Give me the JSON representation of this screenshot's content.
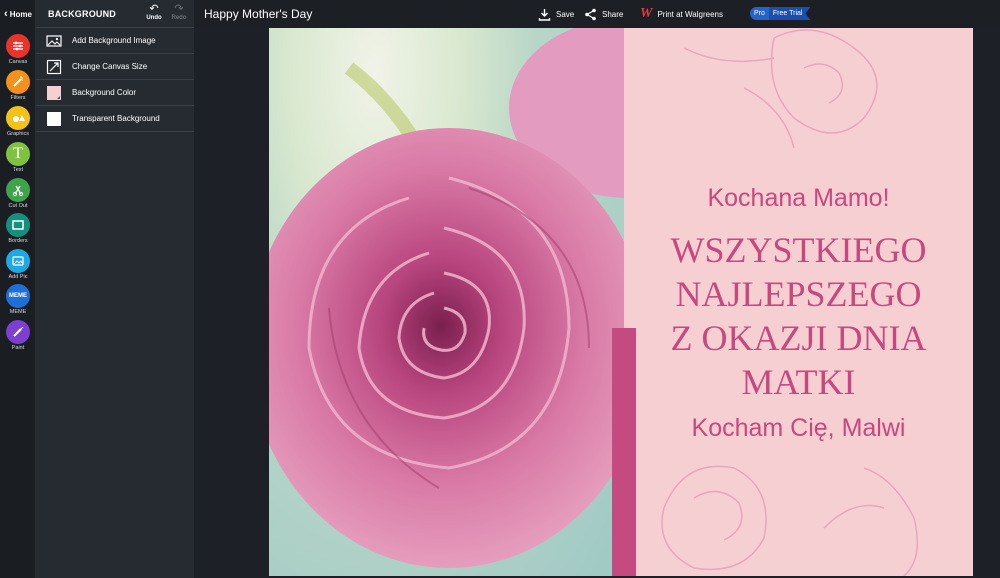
{
  "nav": {
    "home_label": "Home"
  },
  "tools": [
    {
      "label": "Canvas",
      "icon": "sliders-icon",
      "color": "#e8352a"
    },
    {
      "label": "Filters",
      "icon": "wand-icon",
      "color": "#f2911b"
    },
    {
      "label": "Graphics",
      "icon": "shapes-icon",
      "color": "#f3c21a"
    },
    {
      "label": "Text",
      "icon": "text-icon",
      "color": "#7fc242"
    },
    {
      "label": "Cut Out",
      "icon": "cutout-icon",
      "color": "#3ea34a"
    },
    {
      "label": "Borders",
      "icon": "frame-icon",
      "color": "#15907f"
    },
    {
      "label": "Add Pic",
      "icon": "image-add-icon",
      "color": "#1fa9e3"
    },
    {
      "label": "MEME",
      "icon": "meme-icon",
      "color": "#1e6fd8"
    },
    {
      "label": "Paint",
      "icon": "brush-icon",
      "color": "#7c3fd0"
    }
  ],
  "panel": {
    "title": "BACKGROUND",
    "undo_label": "Undo",
    "redo_label": "Redo",
    "options": [
      {
        "label": "Add Background Image",
        "icon": "image-icon"
      },
      {
        "label": "Change Canvas Size",
        "icon": "resize-icon"
      },
      {
        "label": "Background Color",
        "icon": "color-swatch-icon",
        "swatch": "#f6cfd3"
      },
      {
        "label": "Transparent Background",
        "icon": "transparent-icon",
        "swatch": "#ffffff"
      }
    ]
  },
  "topbar": {
    "doc_title": "Happy Mother's Day",
    "save_label": "Save",
    "share_label": "Share",
    "print_label": "Print at Walgreens",
    "pro_label": "Pro",
    "trial_label": "Free Trial"
  },
  "card": {
    "greeting": "Kochana Mamo!",
    "main_lines": [
      "WSZYSTKIEGO",
      "NAJLEPSZEGO",
      "Z OKAZJI DNIA",
      "MATKI"
    ],
    "signoff": "Kocham Cię, Malwi",
    "colors": {
      "background": "#f6cfd3",
      "text": "#c8487e",
      "stripe": "#c54a7f"
    }
  }
}
